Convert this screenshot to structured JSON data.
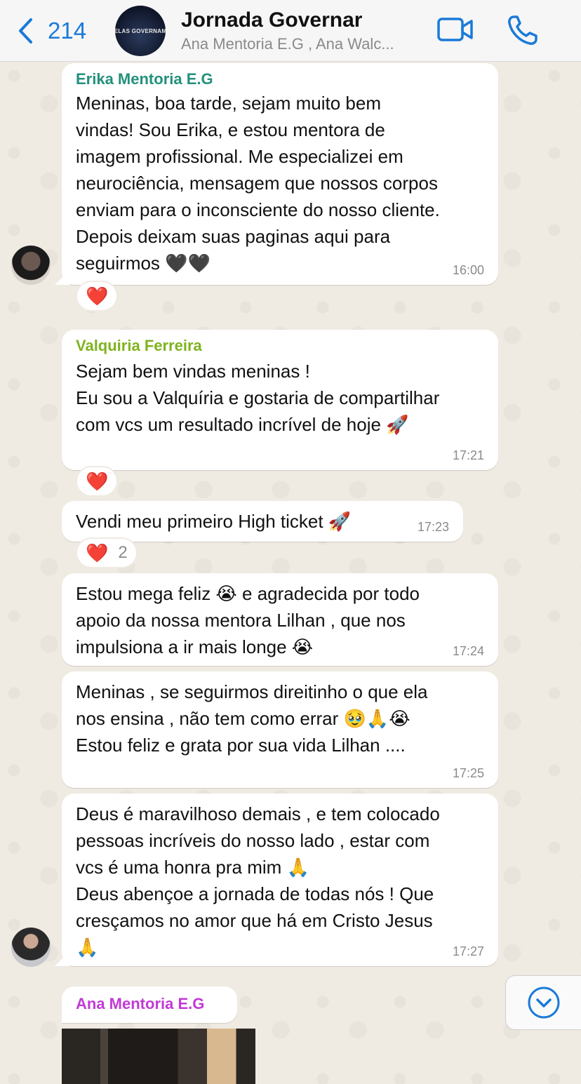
{
  "header": {
    "back_count": "214",
    "group_avatar_text": "ELAS GOVERNAM",
    "title": "Jornada Governar",
    "subtitle": "Ana Mentoria E.G , Ana Walc..."
  },
  "messages": [
    {
      "sender": "Erika Mentoria E.G",
      "sender_color": "#23917c",
      "text": "Meninas, boa tarde, sejam muito bem\nvindas! Sou Erika, e estou mentora de\nimagem profissional. Me especializei em\nneurociência, mensagem que nossos corpos\nenviam para o inconsciente do nosso cliente.\nDepois deixam suas paginas aqui para\nseguirmos 🖤🖤",
      "time": "16:00",
      "reaction": "❤️"
    },
    {
      "sender": "Valquiria Ferreira",
      "sender_color": "#7fb31f",
      "text": "Sejam bem vindas meninas !\nEu sou a Valquíria e gostaria de compartilhar\ncom vcs um resultado incrível de hoje 🚀",
      "time": "17:21",
      "reaction": "❤️"
    },
    {
      "text": "Vendi meu primeiro High ticket 🚀",
      "time": "17:23",
      "reaction": "❤️",
      "reaction_count": "2"
    },
    {
      "text": "Estou mega feliz 😭 e agradecida por todo\napoio da nossa mentora Lilhan , que nos\nimpulsiona a ir mais longe 😭",
      "time": "17:24"
    },
    {
      "text": "Meninas , se seguirmos direitinho o que ela\nnos ensina , não tem como errar 🥹🙏😭\nEstou feliz e grata por sua vida Lilhan ....",
      "time": "17:25"
    },
    {
      "text": "Deus é maravilhoso demais , e tem colocado\npessoas incríveis do nosso lado , estar com\nvcs é uma honra pra mim 🙏\nDeus abençoe a jornada de todas nós ! Que\ncresçamos no amor que há em Cristo Jesus\n🙏",
      "time": "17:27"
    },
    {
      "sender": "Ana Mentoria E.G",
      "sender_color": "#c13ad6"
    }
  ],
  "icons": {
    "back": "chevron-left-icon",
    "video": "video-camera-icon",
    "call": "phone-icon",
    "scroll": "chevron-down-circle-icon"
  },
  "colors": {
    "accent": "#1a7ad9",
    "chat_background": "#efeae2",
    "bubble": "#ffffff"
  }
}
